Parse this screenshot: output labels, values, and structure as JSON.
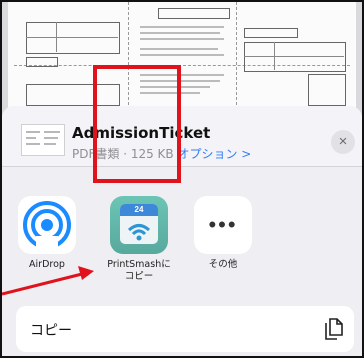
{
  "sheet": {
    "title": "AdmissionTicket",
    "subtitle_meta": "PDF書類 · 125 KB",
    "subtitle_link": "オプション >",
    "close_glyph": "×",
    "accent_color": "#2f7cf6"
  },
  "apps": [
    {
      "label": "AirDrop",
      "icon": "airdrop-icon"
    },
    {
      "label_line1": "PrintSmashに",
      "label_line2": "コピー",
      "icon": "printsmash-icon",
      "badge": "24"
    },
    {
      "label": "その他",
      "icon": "more-icon"
    }
  ],
  "more_glyph": "•••",
  "actions": {
    "copy_label": "コピー",
    "copy_icon": "copy-document-icon"
  },
  "highlight_color": "#e0121b"
}
